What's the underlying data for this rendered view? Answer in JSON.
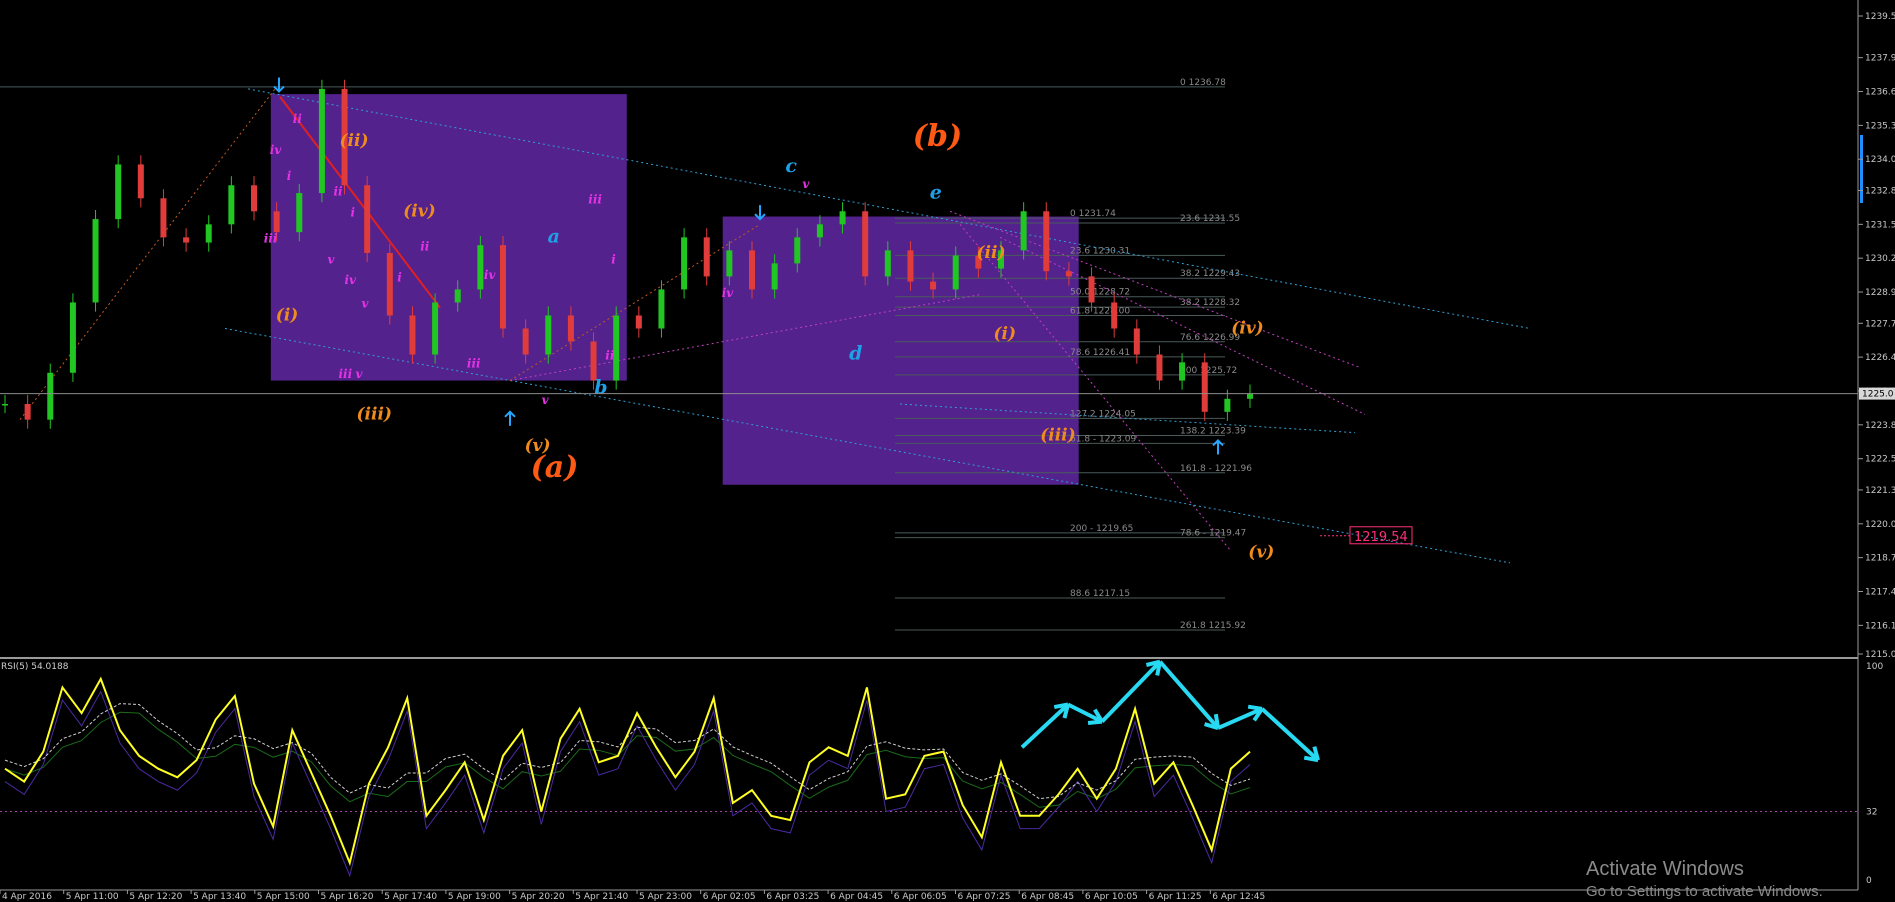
{
  "chart_data": [
    {
      "type": "line",
      "panel": "price",
      "instrument_style": "candlestick",
      "ylim": [
        1215.0,
        1239.5
      ],
      "y_ticks": [
        "1239.5",
        "1237.9",
        "1236.6",
        "1235.3",
        "1234.0",
        "1232.8",
        "1231.5",
        "1230.2",
        "1228.9",
        "1227.7",
        "1226.4",
        "1225.1",
        "1223.8",
        "1222.5",
        "1221.3",
        "1220.0",
        "1218.7",
        "1217.4",
        "1216.1",
        "1215.0"
      ],
      "current_price_label": "1225.0",
      "x_ticks": [
        "4 Apr 2016",
        "5 Apr 11:00",
        "5 Apr 12:20",
        "5 Apr 13:40",
        "5 Apr 15:00",
        "5 Apr 16:20",
        "5 Apr 17:40",
        "5 Apr 19:00",
        "5 Apr 20:20",
        "5 Apr 21:40",
        "5 Apr 23:00",
        "6 Apr 02:05",
        "6 Apr 03:25",
        "6 Apr 04:45",
        "6 Apr 06:05",
        "6 Apr 07:25",
        "6 Apr 08:45",
        "6 Apr 10:05",
        "6 Apr 11:25",
        "6 Apr 12:45"
      ],
      "series": [
        {
          "values": [
            1224.6,
            1224.0,
            1225.8,
            1228.5,
            1231.7,
            1233.8,
            1232.5,
            1231.0,
            1230.8,
            1231.5,
            1233.0,
            1232.0,
            1231.2,
            1232.7,
            1236.7,
            1233.0,
            1230.4,
            1228.0,
            1226.5,
            1228.5,
            1229.0,
            1230.7,
            1227.5,
            1226.5,
            1228.0,
            1227.0,
            1225.5,
            1228.0,
            1227.5,
            1229.0,
            1231.0,
            1229.5,
            1230.5,
            1229.0,
            1230.0,
            1231.0,
            1231.5,
            1232.0,
            1229.5,
            1230.5,
            1229.3,
            1229.0,
            1230.3,
            1229.8,
            1230.5,
            1232.0,
            1229.7,
            1229.5,
            1228.5,
            1227.5,
            1226.5,
            1225.5,
            1226.2,
            1224.3,
            1224.8,
            1225.0
          ]
        }
      ],
      "fib_levels": [
        {
          "label": "0 1236.78",
          "value": 1236.78
        },
        {
          "label": "0 1231.74",
          "value": 1231.74
        },
        {
          "label": "23.6 1231.55",
          "value": 1231.55
        },
        {
          "label": "23.6 1230.31",
          "value": 1230.31
        },
        {
          "label": "38.2 1229.43",
          "value": 1229.43
        },
        {
          "label": "50.0 1228.72",
          "value": 1228.72
        },
        {
          "label": "38.2 1228.32",
          "value": 1228.32
        },
        {
          "label": "61.8 1228.00",
          "value": 1228.0
        },
        {
          "label": "76.6 1226.99",
          "value": 1226.99
        },
        {
          "label": "78.6 1226.41",
          "value": 1226.41
        },
        {
          "label": "100 1225.72",
          "value": 1225.72
        },
        {
          "label": "127.2 1224.05",
          "value": 1224.05
        },
        {
          "label": "138.2 1223.39",
          "value": 1223.39
        },
        {
          "label": "61.8 - 1223.09",
          "value": 1223.09
        },
        {
          "label": "161.8 - 1221.96",
          "value": 1221.96
        },
        {
          "label": "200 - 1219.65",
          "value": 1219.65
        },
        {
          "label": "78.6 - 1219.47",
          "value": 1219.47
        },
        {
          "label": "88.6 1217.15",
          "value": 1217.15
        },
        {
          "label": "261.8 1215.92",
          "value": 1215.92
        }
      ],
      "target_label": "1219.54",
      "wave_labels": [
        {
          "text": "(a)",
          "color": "#ff5a14",
          "x": "5 Apr 20:20",
          "y": 1221.8
        },
        {
          "text": "(b)",
          "color": "#ff5a14",
          "x": "6 Apr 06:05",
          "y": 1234.5
        },
        {
          "text": "a",
          "color": "#1fa0e6",
          "x": "5 Apr 20:20",
          "y": 1230.8
        },
        {
          "text": "b",
          "color": "#1fa0e6",
          "x": "5 Apr 21:40",
          "y": 1225.0
        },
        {
          "text": "c",
          "color": "#1fa0e6",
          "x": "6 Apr 03:25",
          "y": 1233.5
        },
        {
          "text": "d",
          "color": "#1fa0e6",
          "x": "6 Apr 04:45",
          "y": 1226.3
        },
        {
          "text": "e",
          "color": "#1fa0e6",
          "x": "6 Apr 06:05",
          "y": 1232.5
        },
        {
          "text": "(i)",
          "color": "#f08c1e",
          "x": "5 Apr 15:00",
          "y": 1227.8
        },
        {
          "text": "(ii)",
          "color": "#f08c1e",
          "x": "5 Apr 16:20",
          "y": 1234.5
        },
        {
          "text": "(iii)",
          "color": "#f08c1e",
          "x": "5 Apr 16:20",
          "y": 1224.0
        },
        {
          "text": "(iv)",
          "color": "#f08c1e",
          "x": "5 Apr 17:40",
          "y": 1231.8
        },
        {
          "text": "(v)",
          "color": "#f08c1e",
          "x": "5 Apr 20:20",
          "y": 1222.8
        },
        {
          "text": "(ii)",
          "color": "#f08c1e",
          "x": "6 Apr 07:25",
          "y": 1230.2
        },
        {
          "text": "(i)",
          "color": "#f08c1e",
          "x": "6 Apr 07:25",
          "y": 1227.1
        },
        {
          "text": "(iii)",
          "color": "#f08c1e",
          "x": "6 Apr 08:45",
          "y": 1223.2
        },
        {
          "text": "(iv)",
          "color": "#f08c1e",
          "x": "6 Apr 12:45",
          "y": 1227.3
        },
        {
          "text": "(v)",
          "color": "#f08c1e",
          "x": "6 Apr 12:45",
          "y": 1218.7
        },
        {
          "text": "ii",
          "color": "#e632e6",
          "x": "5 Apr 15:00",
          "y": 1235.4
        },
        {
          "text": "iv",
          "color": "#e632e6",
          "x": "5 Apr 15:00",
          "y": 1234.2
        },
        {
          "text": "i",
          "color": "#e632e6",
          "x": "5 Apr 15:00",
          "y": 1233.2
        },
        {
          "text": "ii",
          "color": "#e632e6",
          "x": "5 Apr 16:20",
          "y": 1232.6
        },
        {
          "text": "i",
          "color": "#e632e6",
          "x": "5 Apr 16:20",
          "y": 1231.8
        },
        {
          "text": "iii",
          "color": "#e632e6",
          "x": "5 Apr 15:00",
          "y": 1230.8
        },
        {
          "text": "v",
          "color": "#e632e6",
          "x": "5 Apr 16:20",
          "y": 1230.0
        },
        {
          "text": "iv",
          "color": "#e632e6",
          "x": "5 Apr 16:20",
          "y": 1229.2
        },
        {
          "text": "v",
          "color": "#e632e6",
          "x": "5 Apr 16:20",
          "y": 1228.3
        },
        {
          "text": "iii",
          "color": "#e632e6",
          "x": "5 Apr 16:20",
          "y": 1225.6
        },
        {
          "text": "v",
          "color": "#e632e6",
          "x": "5 Apr 16:20",
          "y": 1225.6
        },
        {
          "text": "ii",
          "color": "#e632e6",
          "x": "5 Apr 17:40",
          "y": 1230.5
        },
        {
          "text": "i",
          "color": "#e632e6",
          "x": "5 Apr 17:40",
          "y": 1229.3
        },
        {
          "text": "iii",
          "color": "#e632e6",
          "x": "5 Apr 19:00",
          "y": 1226.0
        },
        {
          "text": "iv",
          "color": "#e632e6",
          "x": "5 Apr 19:00",
          "y": 1229.4
        },
        {
          "text": "v",
          "color": "#e632e6",
          "x": "5 Apr 20:20",
          "y": 1224.6
        },
        {
          "text": "i",
          "color": "#e632e6",
          "x": "5 Apr 21:40",
          "y": 1230.0
        },
        {
          "text": "iii",
          "color": "#e632e6",
          "x": "5 Apr 21:40",
          "y": 1232.3
        },
        {
          "text": "ii",
          "color": "#e632e6",
          "x": "5 Apr 21:40",
          "y": 1226.3
        },
        {
          "text": "v",
          "color": "#e632e6",
          "x": "6 Apr 03:25",
          "y": 1232.9
        },
        {
          "text": "iv",
          "color": "#e632e6",
          "x": "6 Apr 02:05",
          "y": 1228.7
        }
      ]
    },
    {
      "type": "line",
      "panel": "indicator",
      "title": "RSI(5) 54.0188",
      "ylim": [
        0,
        100
      ],
      "y_ticks": [
        "100",
        "32",
        "0"
      ],
      "level": 32,
      "series": [
        {
          "values": [
            52,
            46,
            60,
            90,
            78,
            94,
            70,
            58,
            52,
            48,
            56,
            75,
            86,
            45,
            25,
            70,
            50,
            30,
            8,
            45,
            62,
            85,
            30,
            42,
            55,
            28,
            58,
            70,
            32,
            66,
            80,
            55,
            58,
            78,
            62,
            48,
            60,
            85,
            36,
            42,
            30,
            28,
            55,
            62,
            58,
            90,
            38,
            40,
            58,
            60,
            35,
            20,
            55,
            30,
            30,
            40,
            52,
            38,
            52,
            80,
            45,
            55,
            35,
            14,
            52,
            60
          ]
        }
      ],
      "annotation_path": [
        {
          "x": "6 Apr 07:25",
          "y": 62
        },
        {
          "x": "6 Apr 08:45",
          "y": 82
        },
        {
          "x": "6 Apr 10:05",
          "y": 74
        },
        {
          "x": "6 Apr 10:05",
          "y": 102
        },
        {
          "x": "6 Apr 11:25",
          "y": 71
        },
        {
          "x": "6 Apr 12:45",
          "y": 80
        },
        {
          "x": "6 Apr 12:45",
          "y": 56
        }
      ]
    }
  ],
  "colors": {
    "background": "#000000",
    "bull_candle": "#22c622",
    "bear_candle": "#e03c3c",
    "box": "#6a2cb5",
    "channel": "#2f9fd4",
    "rsi_line": "#ffff24",
    "arrow": "#27d9f2",
    "target": "#ff2e7a"
  },
  "watermark": {
    "title": "Activate Windows",
    "subtitle": "Go to Settings to activate Windows."
  }
}
